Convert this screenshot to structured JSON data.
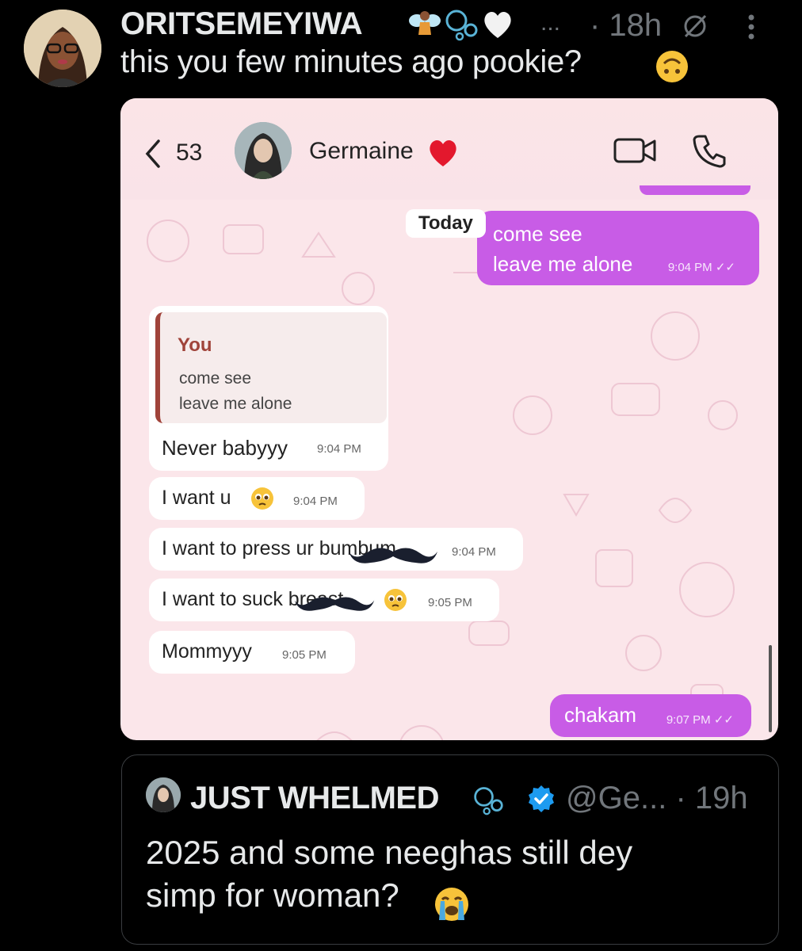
{
  "post": {
    "author_name": "ORITSEMEYIWA",
    "name_emojis": [
      "fairy-emoji",
      "bubbles-emoji",
      "white-heart-emoji"
    ],
    "ellipsis": "...",
    "time": "· 18h",
    "text": "this you few minutes ago pookie?",
    "text_emoji": "upside-down-face-emoji"
  },
  "screenshot": {
    "unread_count": "53",
    "contact_name": "Germaine",
    "day_label": "Today",
    "messages": [
      {
        "dir": "out",
        "lines": [
          "come see",
          "leave me alone"
        ],
        "time": "9:04 PM"
      },
      {
        "dir": "in",
        "reply_author": "You",
        "reply_lines": [
          "come see",
          "leave me alone"
        ],
        "text": "Never babyyy",
        "time": "9:04 PM"
      },
      {
        "dir": "in",
        "text": "I want u",
        "time": "9:04 PM"
      },
      {
        "dir": "in",
        "text": "I want to press ur bumbum",
        "time": "9:04 PM"
      },
      {
        "dir": "in",
        "text": "I want to suck breast",
        "time": "9:05 PM"
      },
      {
        "dir": "in",
        "text": "Mommyyy",
        "time": "9:05 PM"
      },
      {
        "dir": "out",
        "text": "chakam",
        "time": "9:07 PM"
      }
    ]
  },
  "quote": {
    "name": "JUST WHELMED",
    "handle": "@Ge...",
    "time": "· 19h",
    "text_line1": "2025 and some neeghas still dey",
    "text_line2": "simp for woman?",
    "text_emoji": "crying-face-emoji"
  },
  "colors": {
    "background": "#000000",
    "text": "#e7e9ea",
    "muted": "#71767b",
    "outgoing_bubble": "#c85ce6",
    "chat_background": "#fbe6ea",
    "reply_accent": "#a0433a",
    "verified": "#1d9bf0"
  }
}
